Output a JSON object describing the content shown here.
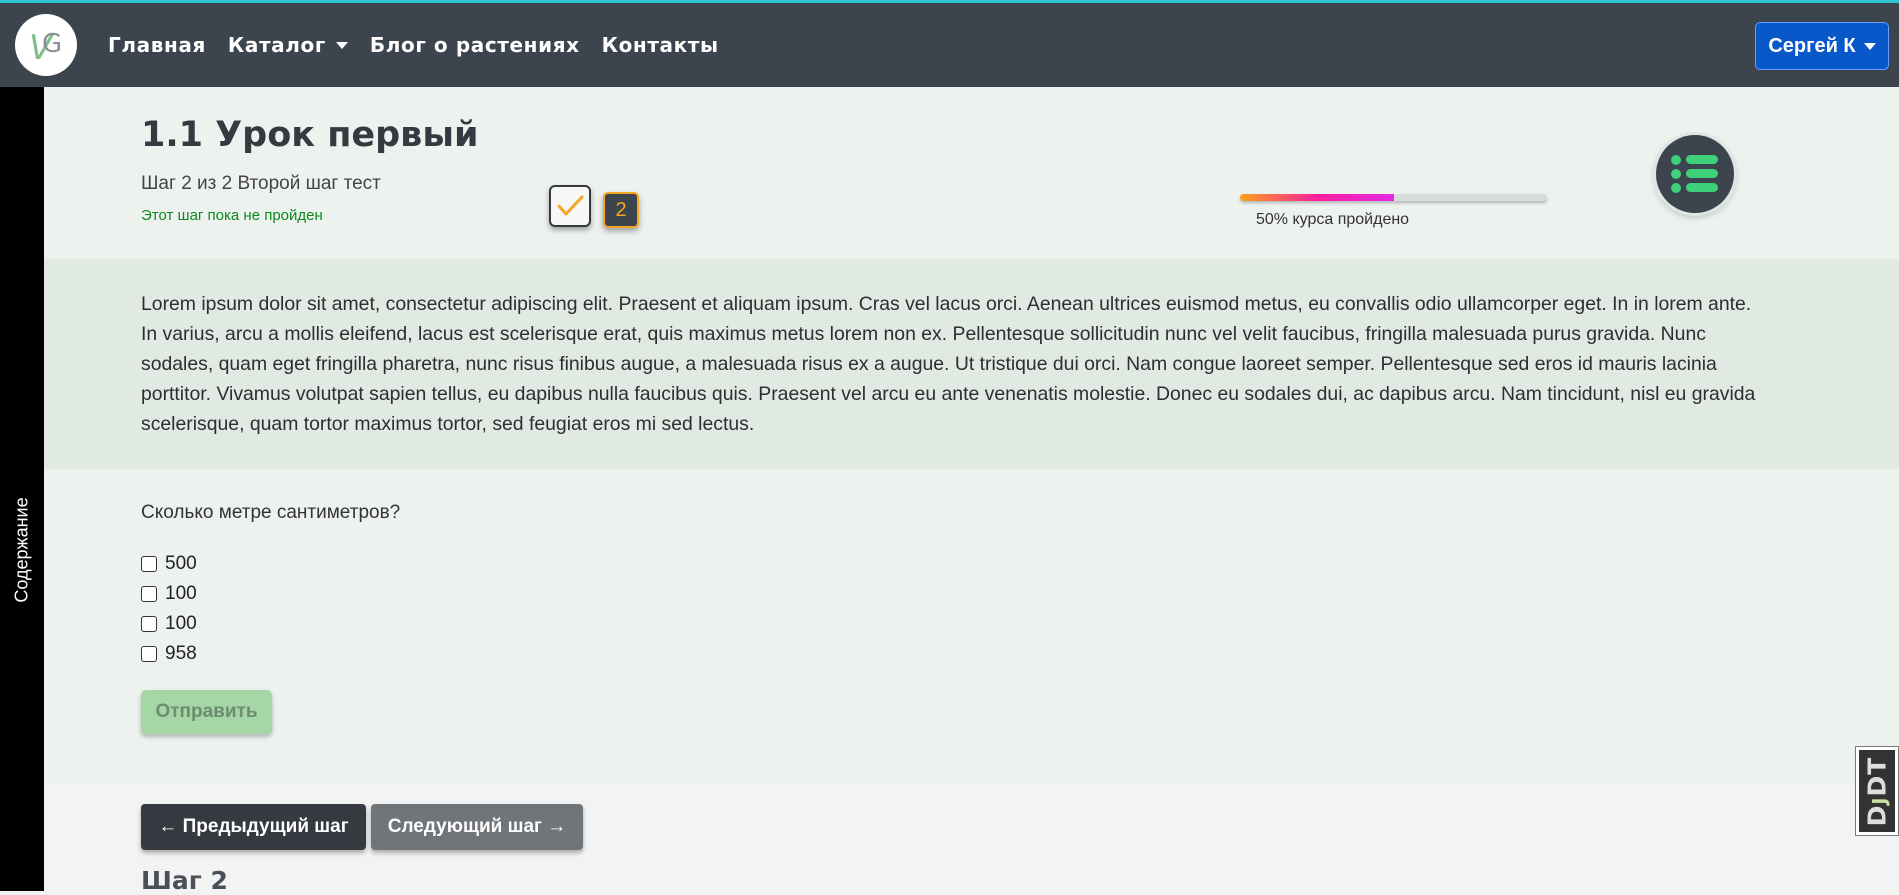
{
  "navbar": {
    "logo_text": "VG",
    "links": [
      {
        "label": "Главная"
      },
      {
        "label": "Каталог"
      },
      {
        "label": "Блог о растениях"
      },
      {
        "label": "Контакты"
      }
    ],
    "user": "Сергей К"
  },
  "sidebar": {
    "label": "Содержание"
  },
  "lesson": {
    "title": "1.1 Урок первый",
    "step_info": "Шаг 2 из 2 Второй шаг тест",
    "status": "Этот шаг пока не пройден",
    "current_step": "2",
    "progress": {
      "label": "50% курса пройдено",
      "value": 0.5
    }
  },
  "content": {
    "text": "Lorem ipsum dolor sit amet, consectetur adipiscing elit. Praesent et aliquam ipsum. Cras vel lacus orci. Aenean ultrices euismod metus, eu convallis odio ullamcorper eget. In in lorem ante. In varius, arcu a mollis eleifend, lacus est scelerisque erat, quis maximus metus lorem non ex. Pellentesque sollicitudin nunc vel velit faucibus, fringilla malesuada purus gravida. Nunc sodales, quam eget fringilla pharetra, nunc risus finibus augue, a malesuada risus ex a augue. Ut tristique dui orci. Nam congue laoreet semper. Pellentesque sed eros id mauris lacinia porttitor. Vivamus volutpat sapien tellus, eu dapibus nulla faucibus quis. Praesent vel arcu eu ante venenatis molestie. Donec eu sodales dui, ac dapibus arcu. Nam tincidunt, nisl eu gravida scelerisque, quam tortor maximus tortor, sed feugiat eros mi sed lectus."
  },
  "quiz": {
    "question": "Сколько метре сантиметров?",
    "options": [
      "500",
      "100",
      "100",
      "958"
    ],
    "submit": "Отправить"
  },
  "navigation": {
    "prev": "← Предыдущий шаг",
    "next": "Следующий шаг →",
    "footer_title": "Шаг 2"
  },
  "debug_toolbar": {
    "label_d": "D",
    "label_j": "J",
    "label_dt": "DT"
  },
  "colors": {
    "navbar": "#3c444d",
    "accent_line": "#2ec4d3",
    "user_button": "#0958c9",
    "status_green": "#0b8a1c",
    "step_orange": "#f5a623",
    "submit_disabled": "#a4d6a6"
  }
}
